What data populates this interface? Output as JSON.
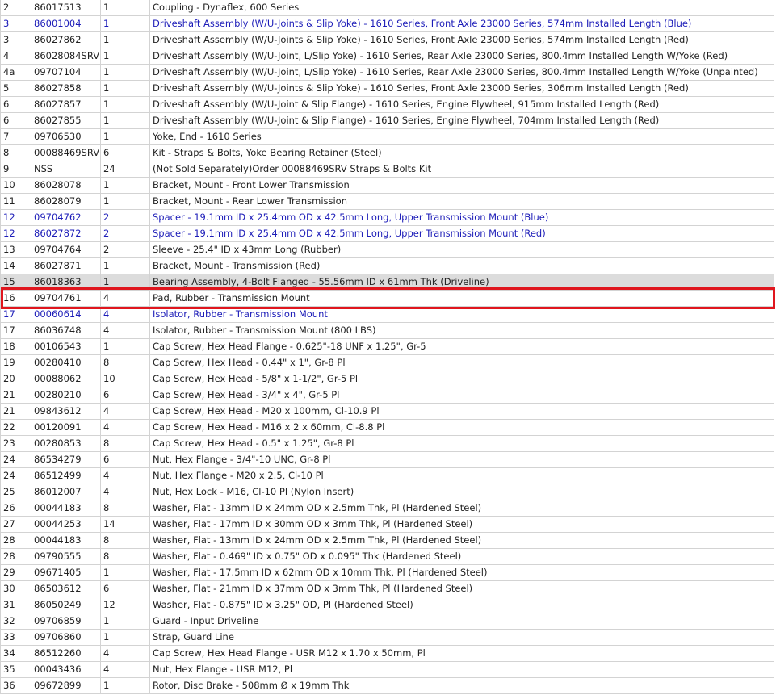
{
  "colors": {
    "link": "#1c1cb8",
    "highlight_bg": "#dcdcdc",
    "selection_border": "#e0161e"
  },
  "selected_row_index": 17,
  "rows": [
    {
      "num": "2",
      "part": "86017513",
      "qty": "1",
      "desc": "Coupling - Dynaflex, 600 Series",
      "link": false
    },
    {
      "num": "3",
      "part": "86001004",
      "qty": "1",
      "desc": "Driveshaft Assembly (W/U-Joints & Slip Yoke) - 1610 Series, Front Axle 23000 Series, 574mm Installed Length (Blue)",
      "link": true
    },
    {
      "num": "3",
      "part": "86027862",
      "qty": "1",
      "desc": "Driveshaft Assembly (W/U-Joints & Slip Yoke) - 1610 Series, Front Axle 23000 Series, 574mm Installed Length (Red)",
      "link": false
    },
    {
      "num": "4",
      "part": "86028084SRV",
      "qty": "1",
      "desc": "Driveshaft Assembly (W/U-Joint, L/Slip Yoke) - 1610 Series, Rear Axle 23000 Series, 800.4mm Installed Length W/Yoke (Red)",
      "link": false
    },
    {
      "num": "4a",
      "part": "09707104",
      "qty": "1",
      "desc": "Driveshaft Assembly (W/U-Joint, L/Slip Yoke) - 1610 Series, Rear Axle 23000 Series, 800.4mm Installed Length W/Yoke (Unpainted)",
      "link": false
    },
    {
      "num": "5",
      "part": "86027858",
      "qty": "1",
      "desc": "Driveshaft Assembly (W/U-Joints & Slip Yoke) - 1610 Series, Front Axle 23000 Series, 306mm Installed Length (Red)",
      "link": false
    },
    {
      "num": "6",
      "part": "86027857",
      "qty": "1",
      "desc": "Driveshaft Assembly (W/U-Joint & Slip Flange) - 1610 Series, Engine Flywheel, 915mm Installed Length (Red)",
      "link": false
    },
    {
      "num": "6",
      "part": "86027855",
      "qty": "1",
      "desc": "Driveshaft Assembly (W/U-Joint & Slip Flange) - 1610 Series, Engine Flywheel, 704mm Installed Length (Red)",
      "link": false
    },
    {
      "num": "7",
      "part": "09706530",
      "qty": "1",
      "desc": "Yoke, End - 1610 Series",
      "link": false
    },
    {
      "num": "8",
      "part": "00088469SRV",
      "qty": "6",
      "desc": "Kit - Straps & Bolts, Yoke Bearing Retainer (Steel)",
      "link": false
    },
    {
      "num": "9",
      "part": "NSS",
      "qty": "24",
      "desc": "(Not Sold Separately)Order 00088469SRV Straps & Bolts Kit",
      "link": false
    },
    {
      "num": "10",
      "part": "86028078",
      "qty": "1",
      "desc": "Bracket, Mount - Front Lower Transmission",
      "link": false
    },
    {
      "num": "11",
      "part": "86028079",
      "qty": "1",
      "desc": "Bracket, Mount - Rear Lower Transmission",
      "link": false
    },
    {
      "num": "12",
      "part": "09704762",
      "qty": "2",
      "desc": "Spacer - 19.1mm ID x 25.4mm OD x 42.5mm Long, Upper Transmission Mount (Blue)",
      "link": true
    },
    {
      "num": "12",
      "part": "86027872",
      "qty": "2",
      "desc": "Spacer - 19.1mm ID x 25.4mm OD x 42.5mm Long, Upper Transmission Mount (Red)",
      "link": true
    },
    {
      "num": "13",
      "part": "09704764",
      "qty": "2",
      "desc": "Sleeve - 25.4\" ID x 43mm Long (Rubber)",
      "link": false
    },
    {
      "num": "14",
      "part": "86027871",
      "qty": "1",
      "desc": "Bracket, Mount - Transmission (Red)",
      "link": false
    },
    {
      "num": "15",
      "part": "86018363",
      "qty": "1",
      "desc": "Bearing Assembly, 4-Bolt Flanged - 55.56mm ID x 61mm Thk (Driveline)",
      "link": false
    },
    {
      "num": "16",
      "part": "09704761",
      "qty": "4",
      "desc": "Pad, Rubber - Transmission Mount",
      "link": false
    },
    {
      "num": "17",
      "part": "00060614",
      "qty": "4",
      "desc": "Isolator, Rubber - Transmission Mount",
      "link": true
    },
    {
      "num": "17",
      "part": "86036748",
      "qty": "4",
      "desc": "Isolator, Rubber - Transmission Mount (800 LBS)",
      "link": false
    },
    {
      "num": "18",
      "part": "00106543",
      "qty": "1",
      "desc": "Cap Screw, Hex Head Flange - 0.625\"-18 UNF x 1.25\", Gr-5",
      "link": false
    },
    {
      "num": "19",
      "part": "00280410",
      "qty": "8",
      "desc": "Cap Screw, Hex Head - 0.44\" x 1\", Gr-8 Pl",
      "link": false
    },
    {
      "num": "20",
      "part": "00088062",
      "qty": "10",
      "desc": "Cap Screw, Hex Head - 5/8\" x 1-1/2\", Gr-5 Pl",
      "link": false
    },
    {
      "num": "21",
      "part": "00280210",
      "qty": "6",
      "desc": "Cap Screw, Hex Head - 3/4\" x 4\", Gr-5 Pl",
      "link": false
    },
    {
      "num": "21",
      "part": "09843612",
      "qty": "4",
      "desc": "Cap Screw, Hex Head - M20 x 100mm, Cl-10.9 Pl",
      "link": false
    },
    {
      "num": "22",
      "part": "00120091",
      "qty": "4",
      "desc": "Cap Screw, Hex Head - M16 x 2 x 60mm, Cl-8.8 Pl",
      "link": false
    },
    {
      "num": "23",
      "part": "00280853",
      "qty": "8",
      "desc": "Cap Screw, Hex Head - 0.5\" x 1.25\", Gr-8 Pl",
      "link": false
    },
    {
      "num": "24",
      "part": "86534279",
      "qty": "6",
      "desc": "Nut, Hex Flange - 3/4\"-10 UNC, Gr-8 Pl",
      "link": false
    },
    {
      "num": "24",
      "part": "86512499",
      "qty": "4",
      "desc": "Nut, Hex Flange - M20 x 2.5, Cl-10 Pl",
      "link": false
    },
    {
      "num": "25",
      "part": "86012007",
      "qty": "4",
      "desc": "Nut, Hex Lock - M16, Cl-10 Pl (Nylon Insert)",
      "link": false
    },
    {
      "num": "26",
      "part": "00044183",
      "qty": "8",
      "desc": "Washer, Flat - 13mm ID x 24mm OD x 2.5mm Thk, Pl (Hardened Steel)",
      "link": false
    },
    {
      "num": "27",
      "part": "00044253",
      "qty": "14",
      "desc": "Washer, Flat - 17mm ID x 30mm OD x 3mm Thk, Pl (Hardened Steel)",
      "link": false
    },
    {
      "num": "28",
      "part": "00044183",
      "qty": "8",
      "desc": "Washer, Flat - 13mm ID x 24mm OD x 2.5mm Thk, Pl (Hardened Steel)",
      "link": false
    },
    {
      "num": "28",
      "part": "09790555",
      "qty": "8",
      "desc": "Washer, Flat - 0.469\" ID x 0.75\" OD x 0.095\" Thk (Hardened Steel)",
      "link": false
    },
    {
      "num": "29",
      "part": "09671405",
      "qty": "1",
      "desc": "Washer, Flat - 17.5mm ID x 62mm OD x 10mm Thk, Pl (Hardened Steel)",
      "link": false
    },
    {
      "num": "30",
      "part": "86503612",
      "qty": "6",
      "desc": "Washer, Flat - 21mm ID x 37mm OD x 3mm Thk, Pl (Hardened Steel)",
      "link": false
    },
    {
      "num": "31",
      "part": "86050249",
      "qty": "12",
      "desc": "Washer, Flat - 0.875\" ID x 3.25\" OD, Pl (Hardened Steel)",
      "link": false
    },
    {
      "num": "32",
      "part": "09706859",
      "qty": "1",
      "desc": "Guard - Input Driveline",
      "link": false
    },
    {
      "num": "33",
      "part": "09706860",
      "qty": "1",
      "desc": "Strap, Guard Line",
      "link": false
    },
    {
      "num": "34",
      "part": "86512260",
      "qty": "4",
      "desc": "Cap Screw, Hex Head Flange - USR M12 x 1.70 x 50mm, Pl",
      "link": false
    },
    {
      "num": "35",
      "part": "00043436",
      "qty": "4",
      "desc": "Nut, Hex Flange - USR M12, Pl",
      "link": false
    },
    {
      "num": "36",
      "part": "09672899",
      "qty": "1",
      "desc": "Rotor, Disc Brake - 508mm Ø x 19mm Thk",
      "link": false
    }
  ]
}
